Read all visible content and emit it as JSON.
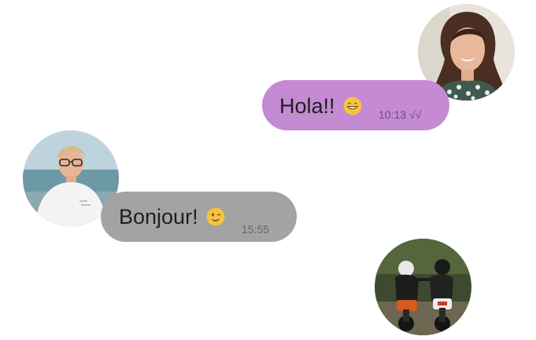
{
  "conversation": {
    "messages": [
      {
        "direction": "outgoing",
        "text": "Hola!!",
        "emoji": "grinning-face-emoji",
        "time": "10:13",
        "status": "√√",
        "bubble_color": "#c48ad2",
        "avatar": "woman-avatar"
      },
      {
        "direction": "incoming",
        "text": "Bonjour!",
        "emoji": "winking-face-emoji",
        "time": "15:55",
        "bubble_color": "#a3a3a3",
        "avatar": "boy-avatar"
      }
    ],
    "extra_avatar": "riders-avatar"
  }
}
